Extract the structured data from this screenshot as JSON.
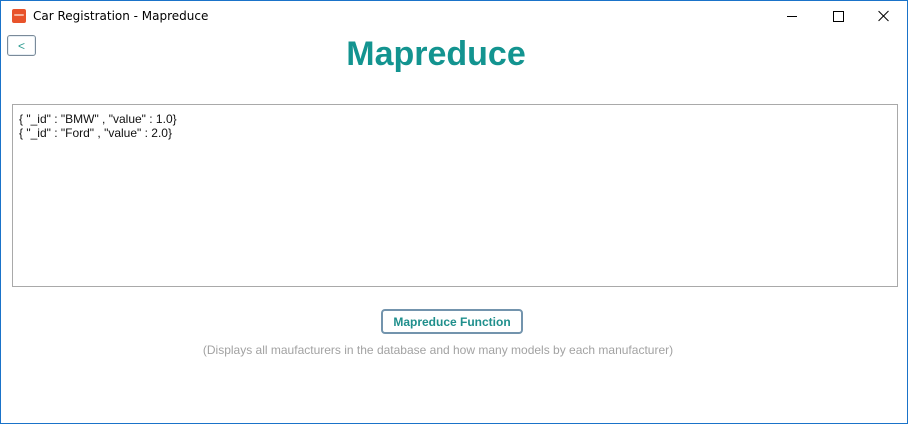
{
  "window": {
    "title": "Car Registration - Mapreduce",
    "icon": "app-icon"
  },
  "controls": {
    "minimize": "minimize-icon",
    "maximize": "maximize-icon",
    "close": "close-icon"
  },
  "header": {
    "back_label": "<",
    "title": "Mapreduce",
    "title_color": "#139490"
  },
  "output": {
    "lines": [
      "{ \"_id\" : \"BMW\" , \"value\" : 1.0}",
      "{ \"_id\" : \"Ford\" , \"value\" : 2.0}"
    ]
  },
  "action": {
    "button_label": "Mapreduce Function",
    "description": "(Displays all maufacturers in the database and how many models by each manufacturer)"
  }
}
